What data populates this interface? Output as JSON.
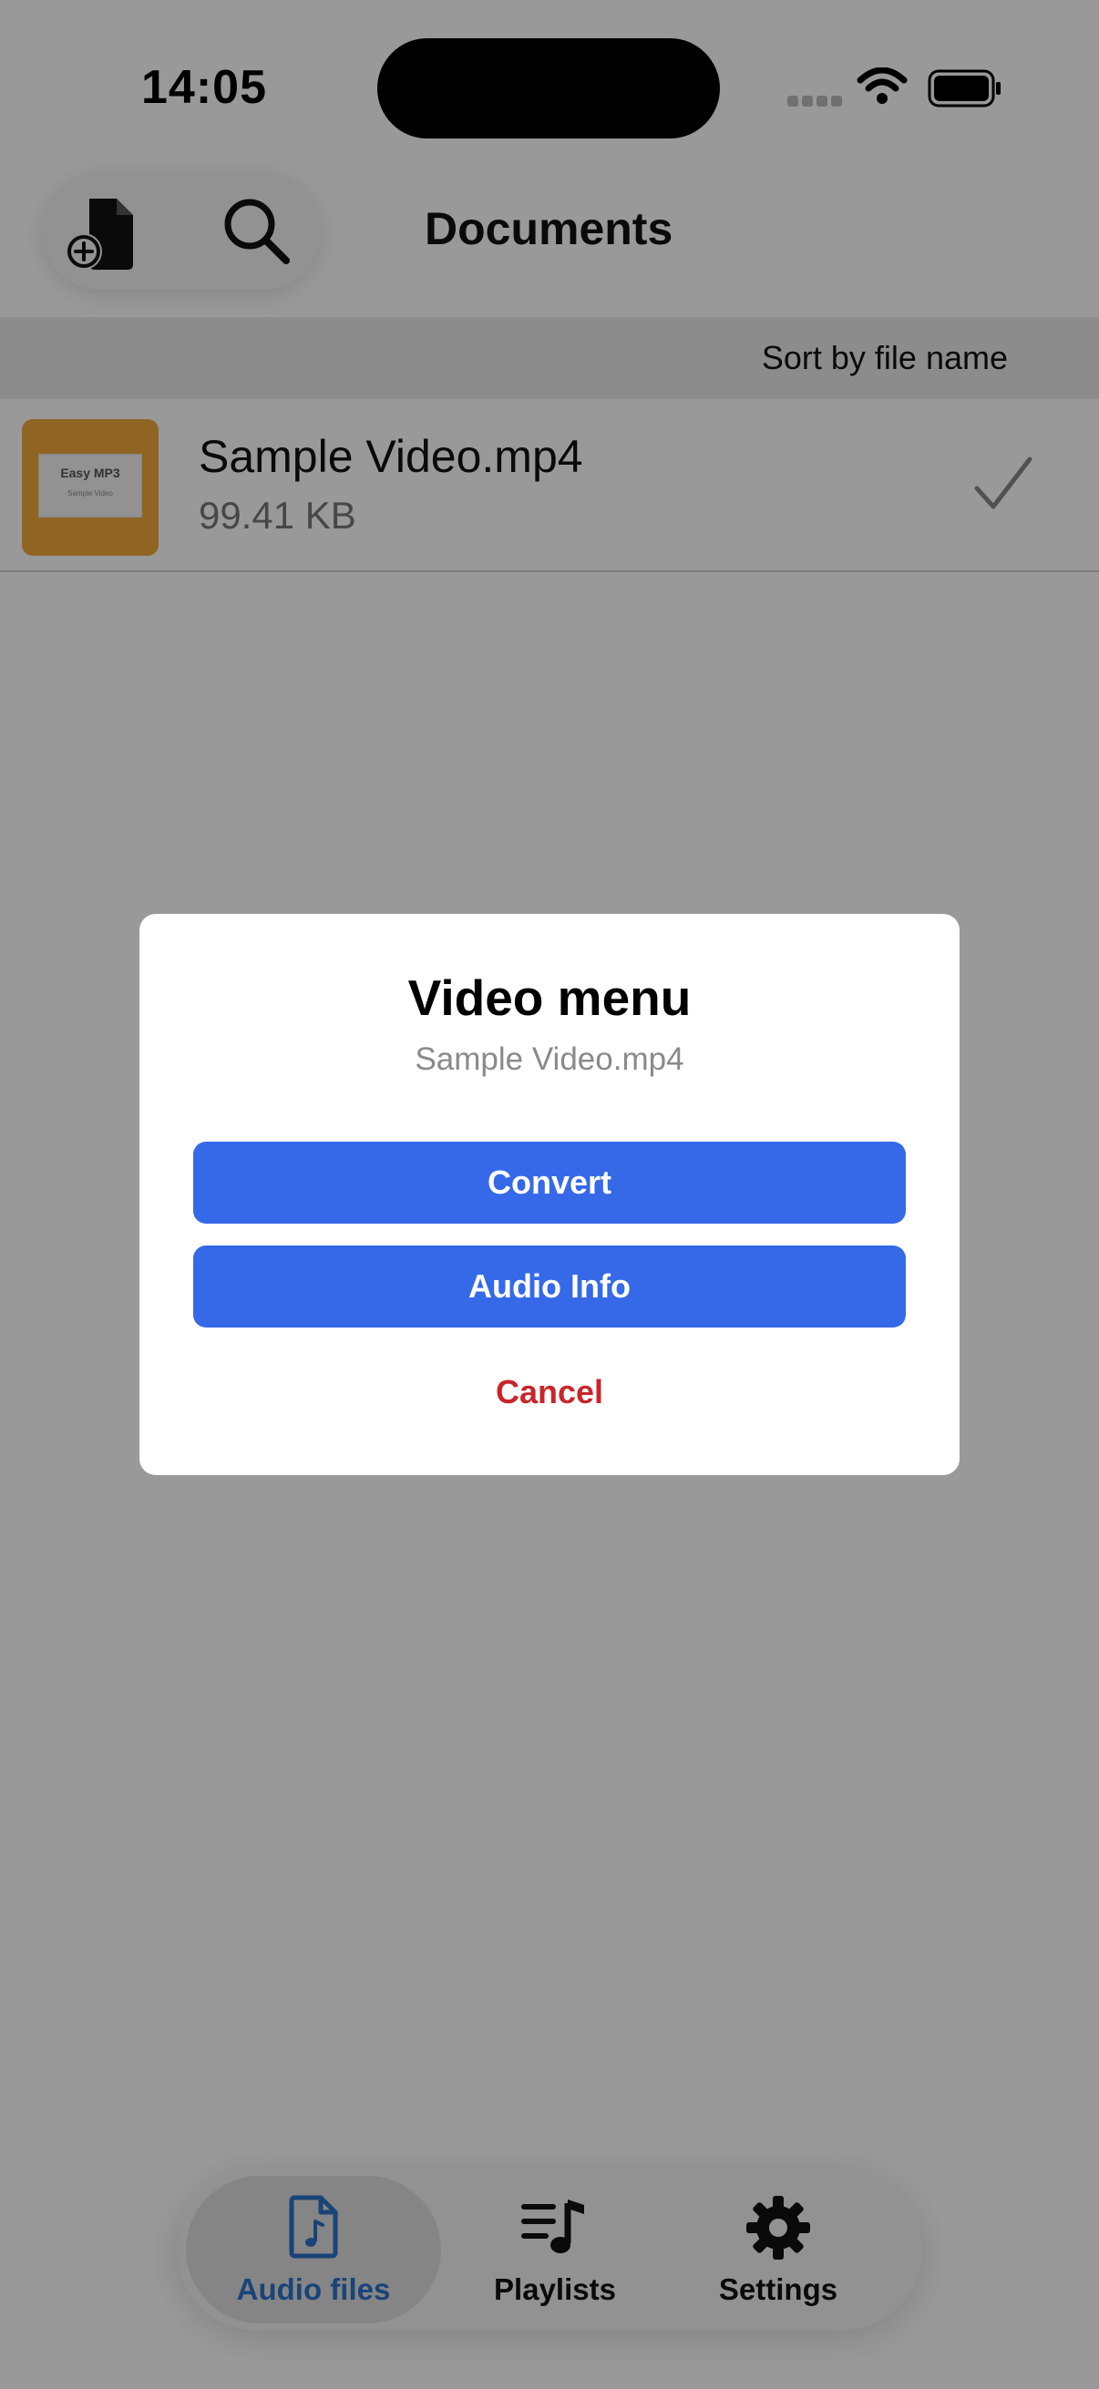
{
  "status_bar": {
    "time": "14:05"
  },
  "header": {
    "title": "Documents"
  },
  "sort": {
    "label": "Sort by file name"
  },
  "files": [
    {
      "name": "Sample Video.mp4",
      "size": "99.41 KB",
      "thumb_title": "Easy MP3",
      "thumb_sub": "Sample Video"
    }
  ],
  "tabs": [
    {
      "label": "Audio files",
      "icon": "audio-file-icon",
      "active": true
    },
    {
      "label": "Playlists",
      "icon": "playlist-icon",
      "active": false
    },
    {
      "label": "Settings",
      "icon": "gear-icon",
      "active": false
    }
  ],
  "dialog": {
    "title": "Video menu",
    "subtitle": "Sample Video.mp4",
    "convert_label": "Convert",
    "info_label": "Audio Info",
    "cancel_label": "Cancel"
  },
  "colors": {
    "accent": "#3569e8",
    "danger": "#c8262a",
    "tab_active": "#2a72c9",
    "thumb": "#f0a83c"
  }
}
